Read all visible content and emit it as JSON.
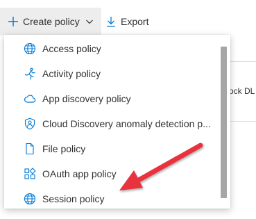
{
  "toolbar": {
    "create_label": "Create policy",
    "export_label": "Export"
  },
  "background": {
    "partial_text": "ock DL f"
  },
  "menu": {
    "items": [
      {
        "label": "Access policy",
        "icon": "globe-icon"
      },
      {
        "label": "Activity policy",
        "icon": "running-person-icon"
      },
      {
        "label": "App discovery policy",
        "icon": "cloud-icon"
      },
      {
        "label": "Cloud Discovery anomaly detection p...",
        "icon": "shield-person-icon"
      },
      {
        "label": "File policy",
        "icon": "file-icon"
      },
      {
        "label": "OAuth app policy",
        "icon": "app-blocks-icon"
      },
      {
        "label": "Session policy",
        "icon": "globe-icon"
      }
    ]
  },
  "annotation": {
    "arrow_color": "#e8333d",
    "points_to": "Session policy"
  },
  "colors": {
    "accent": "#0078d4",
    "toolbar_active_bg": "#ededed",
    "scrollbar_thumb": "#a6a6a6"
  }
}
